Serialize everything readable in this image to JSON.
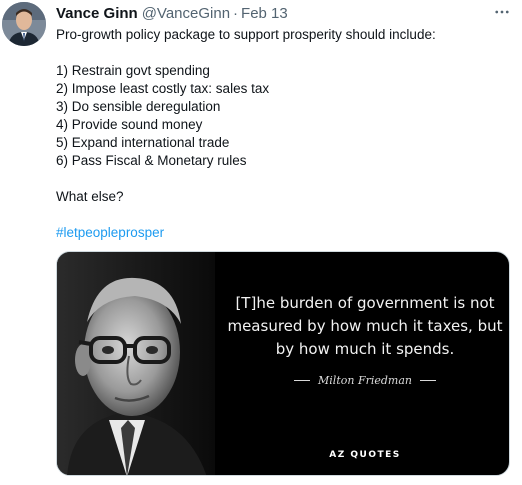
{
  "author": {
    "display_name": "Vance Ginn",
    "handle": "@VanceGinn",
    "separator": "·",
    "timestamp": "Feb 13"
  },
  "more_icon": "more-horizontal-icon",
  "tweet_lines": {
    "intro": "Pro-growth policy package to support prosperity should include:",
    "items": [
      "1) Restrain govt spending",
      "2) Impose least costly tax: sales tax",
      "3) Do sensible deregulation",
      "4) Provide sound money",
      "5) Expand international trade",
      "6) Pass Fiscal & Monetary rules"
    ],
    "question": "What else?",
    "hashtag": "#letpeopleprosper"
  },
  "media": {
    "quote": "[T]he burden of government is not measured by how much it taxes, but by how much it spends.",
    "attribution": "Milton Friedman",
    "brand": "AZ QUOTES"
  },
  "colors": {
    "link": "#1d9bf0",
    "secondary_text": "#536471",
    "primary_text": "#0f1419",
    "media_background": "#000000"
  }
}
